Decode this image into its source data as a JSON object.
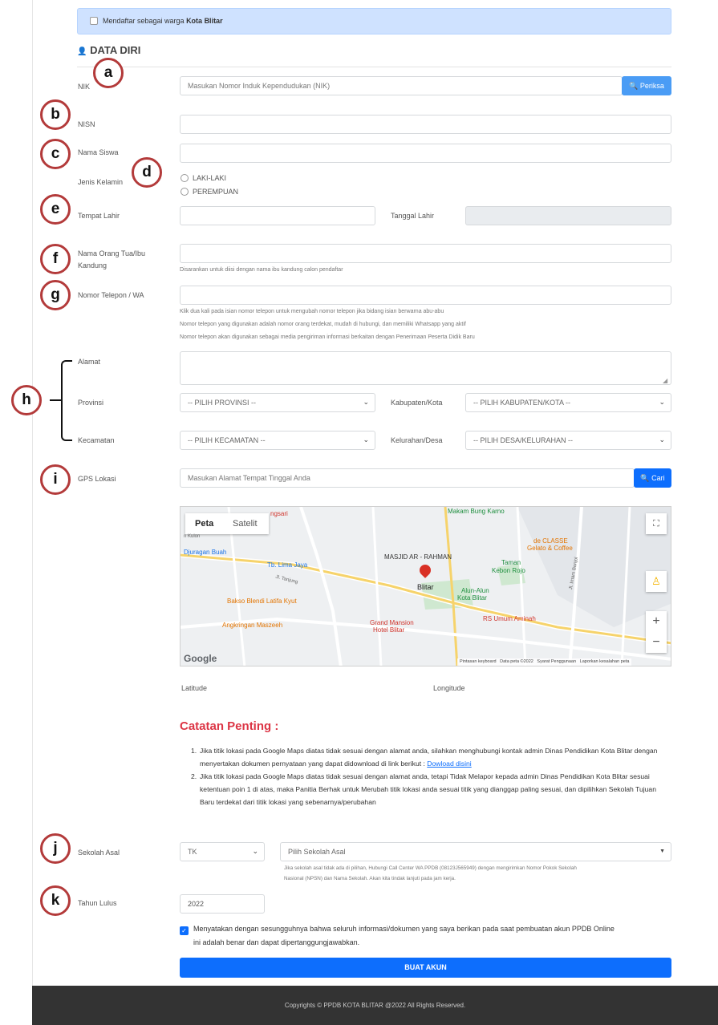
{
  "warga_banner": {
    "prefix": "Mendaftar sebagai warga ",
    "city": "Kota Blitar"
  },
  "section_title": "DATA DIRI",
  "markers": {
    "a": "a",
    "b": "b",
    "c": "c",
    "d": "d",
    "e": "e",
    "f": "f",
    "g": "g",
    "h": "h",
    "i": "i",
    "j": "j",
    "k": "k"
  },
  "fields": {
    "nik_label": "NIK",
    "nik_placeholder": "Masukan Nomor Induk Kependudukan (NIK)",
    "periksa_button": "Periksa",
    "nisn_label": "NISN",
    "nama_label": "Nama Siswa",
    "jk_label": "Jenis Kelamin",
    "jk_laki": "LAKI-LAKI",
    "jk_perempuan": "PEREMPUAN",
    "tempat_label": "Tempat Lahir",
    "tanggal_label": "Tanggal Lahir",
    "ortu_label_1": "Nama Orang Tua/Ibu",
    "ortu_label_2": "Kandung",
    "ortu_help": "Disarankan untuk diisi dengan nama ibu kandung calon pendaftar",
    "telp_label": "Nomor Telepon / WA",
    "telp_help_1": "Klik dua kali pada isian nomor telepon untuk mengubah nomor telepon jika bidang isian berwarna abu-abu",
    "telp_help_2": "Nomor telepon yang digunakan adalah nomor orang terdekat, mudah di hubungi, dan memiliki Whatsapp yang aktif",
    "telp_help_3": "Nomor telepon akan digunakan sebagai media pengiriman informasi berkaitan dengan Penerimaan Peserta Didik Baru",
    "alamat_label": "Alamat",
    "provinsi_label": "Provinsi",
    "provinsi_value": "-- PILIH PROVINSI --",
    "kabupaten_label": "Kabupaten/Kota",
    "kabupaten_value": "-- PILIH KABUPATEN/KOTA --",
    "kecamatan_label": "Kecamatan",
    "kecamatan_value": "-- PILIH KECAMATAN --",
    "kelurahan_label": "Kelurahan/Desa",
    "kelurahan_value": "-- PILIH DESA/KELURAHAN --",
    "gps_label": "GPS Lokasi",
    "gps_placeholder": "Masukan Alamat Tempat Tinggal Anda",
    "cari_button": "Cari"
  },
  "map": {
    "tab_peta": "Peta",
    "tab_satelit": "Satelit",
    "pois": [
      "ngsari",
      "Makam Bung Karno",
      "de CLASSE",
      "Gelato & Coffee",
      "Djuragan Buah",
      "Tb. Lima Jaya",
      "MASJID AR - RAHMAN",
      "Taman",
      "Kebon Rojo",
      "Blitar",
      "Alun-Alun",
      "Kota Blitar",
      "Bakso Blendi Latifa Kyut",
      "RS Umum Aminah",
      "Grand Mansion",
      "Hotel Blitar",
      "Angkringan Maszeeh",
      "Jl. Tanjung",
      "Jl. Imam Bonjol",
      "n Kulon"
    ],
    "logo": "Google",
    "footer_items": [
      "Pintasan keyboard",
      "Data peta ©2022",
      "Syarat Penggunaan",
      "Laporkan kesalahan peta"
    ],
    "zoom_in": "+",
    "zoom_out": "−"
  },
  "latitude_label": "Latitude",
  "longitude_label": "Longitude",
  "catatan_title": "Catatan Penting :",
  "notes": {
    "n1_a": "Jika titik lokasi pada Google Maps diatas tidak sesuai dengan alamat anda, silahkan menghubungi kontak admin Dinas Pendidikan Kota Blitar dengan menyertakan dokumen pernyataan yang dapat didownload di link berikut : ",
    "n1_link": "Dowload disini",
    "n2": "Jika titik lokasi pada Google Maps diatas tidak sesuai dengan alamat anda, tetapi Tidak Melapor kepada admin Dinas Pendidikan Kota Blitar sesuai ketentuan poin 1 di atas, maka Panitia Berhak untuk Merubah titik lokasi anda sesuai titik yang dianggap paling sesuai, dan dipilihkan Sekolah Tujuan Baru terdekat dari titik lokasi yang sebenarnya/perubahan"
  },
  "sekolah": {
    "label": "Sekolah Asal",
    "jenjang_value": "TK",
    "pilih_value": "Pilih Sekolah Asal",
    "help_1": "Jika sekolah asal tidak ada di pilihan, Hubungi Call Center WA PPDB (08123J565949) dengan mengirimkan Nomor Pokok Sekolah",
    "help_2": "Nasional (NPSN) dan Nama Sekolah. Akan kita tindak lanjuti pada jam kerja."
  },
  "tahun": {
    "label": "Tahun Lulus",
    "value": "2022"
  },
  "agreement": {
    "line1": "Menyatakan dengan sesungguhnya bahwa seluruh informasi/dokumen yang saya berikan pada saat pembuatan akun PPDB Online",
    "line2": "ini adalah benar dan dapat dipertanggungjawabkan."
  },
  "submit_button": "BUAT AKUN",
  "footer_text": "Copyrights © PPDB KOTA BLITAR @2022 All Rights Reserved.",
  "colors": {
    "primary": "#0d6efd",
    "catatan": "#dc3545",
    "marker_ring": "#b33a3a",
    "footer_bg": "#333333"
  }
}
